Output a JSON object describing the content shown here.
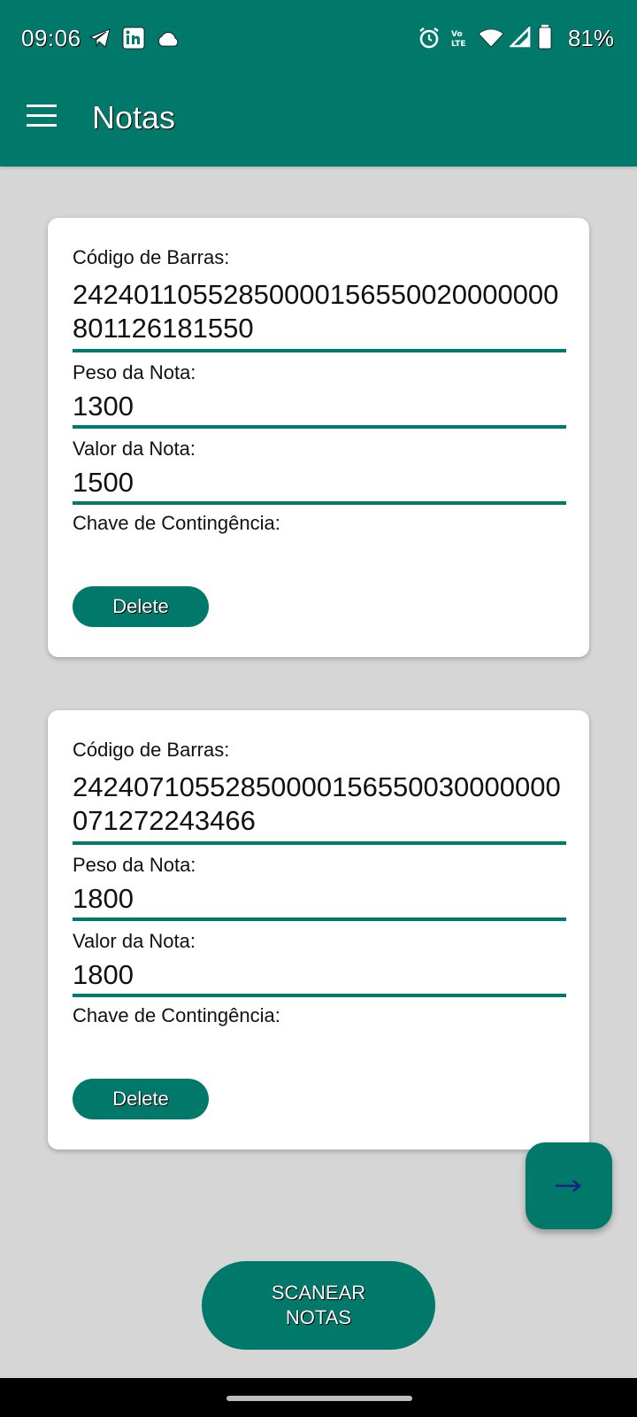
{
  "status_bar": {
    "time": "09:06",
    "battery_text": "81%",
    "left_icons": [
      "telegram-icon",
      "linkedin-icon",
      "cloud-icon"
    ],
    "right_icons": [
      "alarm-icon",
      "volte-icon",
      "wifi-icon",
      "signal-icon",
      "battery-icon"
    ]
  },
  "app_bar": {
    "title": "Notas",
    "menu_icon": "hamburger-menu-icon"
  },
  "notes": [
    {
      "barcode_label": "Código de Barras:",
      "barcode_value": "24240110552850000156550020000000801126181550",
      "weight_label": "Peso da Nota:",
      "weight_value": "1300",
      "value_label": "Valor da Nota:",
      "value_value": "1500",
      "key_label": "Chave de Contingência:",
      "delete_label": "Delete"
    },
    {
      "barcode_label": "Código de Barras:",
      "barcode_value": "24240710552850000156550030000000071272243466",
      "weight_label": "Peso da Nota:",
      "weight_value": "1800",
      "value_label": "Valor da Nota:",
      "value_value": "1800",
      "key_label": "Chave de Contingência:",
      "delete_label": "Delete"
    }
  ],
  "fab": {
    "icon": "arrow-right-icon"
  },
  "scan_button": {
    "label": "SCANEAR NOTAS"
  },
  "colors": {
    "primary": "#00796b",
    "background": "#d6d6d6",
    "arrow": "#1a237e"
  }
}
